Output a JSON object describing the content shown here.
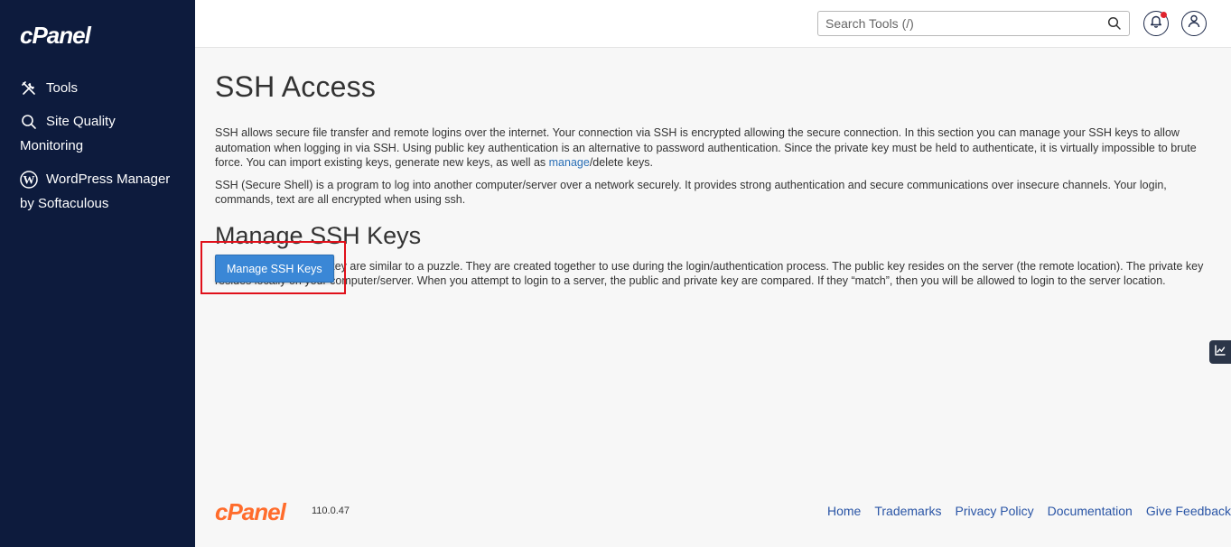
{
  "sidebar": {
    "logo": "cPanel",
    "items": [
      {
        "label": "Tools",
        "icon": "tools-icon"
      },
      {
        "label": "Site Quality",
        "label2": "Monitoring",
        "icon": "search-icon"
      },
      {
        "label": "WordPress Manager",
        "label2": "by Softaculous",
        "icon": "wordpress-icon"
      }
    ]
  },
  "header": {
    "search_placeholder": "Search Tools (/)"
  },
  "main": {
    "title": "SSH Access",
    "intro1_a": "SSH allows secure file transfer and remote logins over the internet. Your connection via SSH is encrypted allowing the secure connection. In this section you can manage your SSH keys to allow automation when logging in via SSH. Using public key authentication is an alternative to password authentication. Since the private key must be held to authenticate, it is virtually impossible to brute force. You can import existing keys, generate new keys, as well as ",
    "intro1_link": "manage",
    "intro1_b": "/delete keys.",
    "intro2": "SSH (Secure Shell) is a program to log into another computer/server over a network securely. It provides strong authentication and secure communications over insecure channels. Your login, commands, text are all encrypted when using ssh.",
    "section_title": "Manage SSH Keys",
    "section_text": "The public and private key are similar to a puzzle. They are created together to use during the login/authentication process. The public key resides on the server (the remote location). The private key resides locally on your computer/server. When you attempt to login to a server, the public and private key are compared. If they “match”, then you will be allowed to login to the server location.",
    "button_label": "Manage SSH Keys"
  },
  "footer": {
    "logo": "cPanel",
    "version": "110.0.47",
    "links": [
      "Home",
      "Trademarks",
      "Privacy Policy",
      "Documentation",
      "Give Feedback"
    ]
  },
  "colors": {
    "sidebar_bg": "#0d1b3d",
    "primary": "#3a87d6",
    "highlight": "#e0101a",
    "brand_orange": "#ff6c2c",
    "link": "#2a55a6"
  }
}
